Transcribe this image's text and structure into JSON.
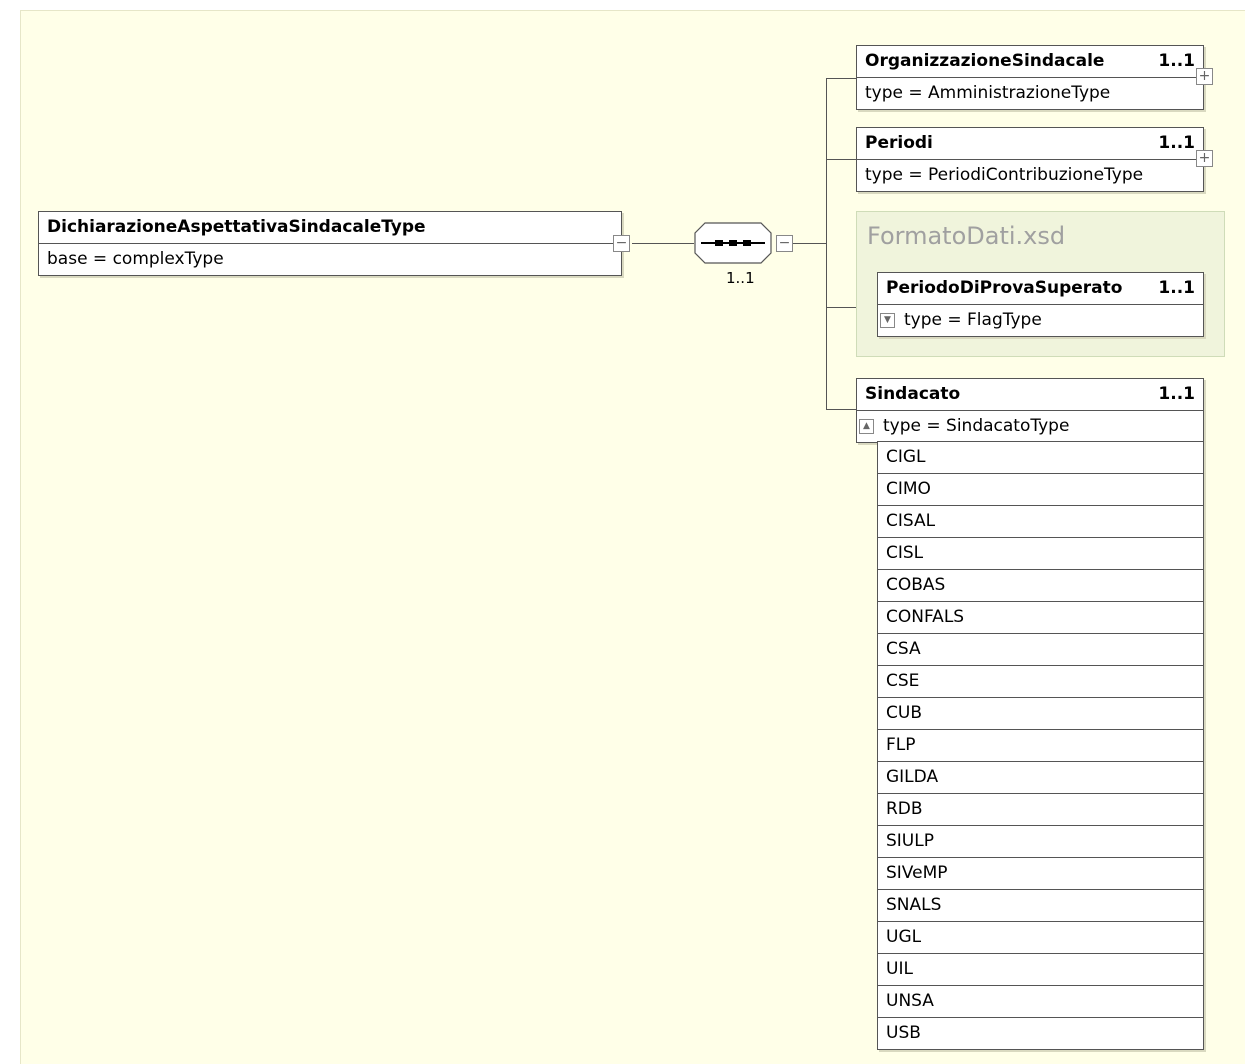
{
  "root": {
    "name": "DichiarazioneAspettativaSindacaleType",
    "sub": "base = complexType"
  },
  "sequence": {
    "cardinality": "1..1"
  },
  "children": [
    {
      "name": "OrganizzazioneSindacale",
      "cardinality": "1..1",
      "sub": "type = AmministrazioneType"
    },
    {
      "name": "Periodi",
      "cardinality": "1..1",
      "sub": "type = PeriodiContribuzioneType"
    }
  ],
  "group": {
    "title": "FormatoDati.xsd",
    "element": {
      "name": "PeriodoDiProvaSuperato",
      "cardinality": "1..1",
      "sub": "type = FlagType"
    }
  },
  "sindacato": {
    "name": "Sindacato",
    "cardinality": "1..1",
    "sub": "type = SindacatoType",
    "values": [
      "CIGL",
      "CIMO",
      "CISAL",
      "CISL",
      "COBAS",
      "CONFALS",
      "CSA",
      "CSE",
      "CUB",
      "FLP",
      "GILDA",
      "RDB",
      "SIULP",
      "SIVeMP",
      "SNALS",
      "UGL",
      "UIL",
      "UNSA",
      "USB"
    ]
  }
}
